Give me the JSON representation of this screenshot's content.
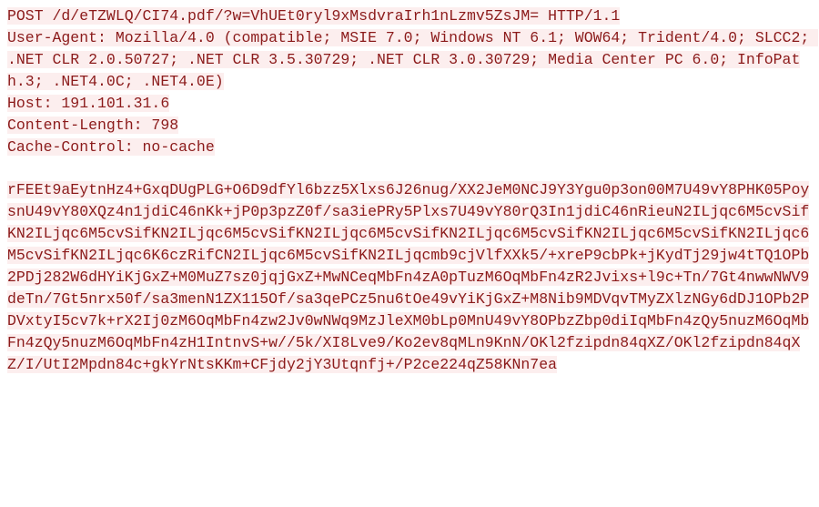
{
  "http_request": {
    "request_line": "POST /d/eTZWLQ/CI74.pdf/?w=VhUEt0ryl9xMsdvraIrh1nLzmv5ZsJM= HTTP/1.1",
    "headers": {
      "user_agent": "User-Agent: Mozilla/4.0 (compatible; MSIE 7.0; Windows NT 6.1; WOW64; Trident/4.0; SLCC2; .NET CLR 2.0.50727; .NET CLR 3.5.30729; .NET CLR 3.0.30729; Media Center PC 6.0; InfoPath.3; .NET4.0C; .NET4.0E)",
      "host": "Host: 191.101.31.6",
      "content_length": "Content-Length: 798",
      "cache_control": "Cache-Control: no-cache"
    },
    "body": "rFEEt9aEytnHz4+GxqDUgPLG+O6D9dfYl6bzz5Xlxs6J26nug/XX2JeM0NCJ9Y3Ygu0p3on00M7U49vY8PHK05PoysnU49vY80XQz4n1jdiC46nKk+jP0p3pzZ0f/sa3iePRy5Plxs7U49vY80rQ3In1jdiC46nRieuN2ILjqc6M5cvSifKN2ILjqc6M5cvSifKN2ILjqc6M5cvSifKN2ILjqc6M5cvSifKN2ILjqc6M5cvSifKN2ILjqc6M5cvSifKN2ILjqc6M5cvSifKN2ILjqc6K6czRifCN2ILjqc6M5cvSifKN2ILjqcmb9cjVlfXXk5/+xreP9cbPk+jKydTj29jw4tTQ1OPb2PDj282W6dHYiKjGxZ+M0MuZ7sz0jqjGxZ+MwNCeqMbFn4zA0pTuzM6OqMbFn4zR2Jvixs+l9c+Tn/7Gt4nwwNWV9deTn/7Gt5nrx50f/sa3menN1ZX115Of/sa3qePCz5nu6tOe49vYiKjGxZ+M8Nib9MDVqvTMyZXlzNGy6dDJ1OPb2PDVxtyI5cv7k+rX2Ij0zM6OqMbFn4zw2Jv0wNWq9MzJleXM0bLp0MnU49vY8OPbzZbp0diIqMbFn4zQy5nuzM6OqMbFn4zQy5nuzM6OqMbFn4zH1IntnvS+w//5k/XI8Lve9/Ko2ev8qMLn9KnN/OKl2fzipdn84qXZ/OKl2fzipdn84qXZ/I/UtI2Mpdn84c+gkYrNtsKKm+CFjdy2jY3Utqnfj+/P2ce224qZ58KNn7ea"
  }
}
